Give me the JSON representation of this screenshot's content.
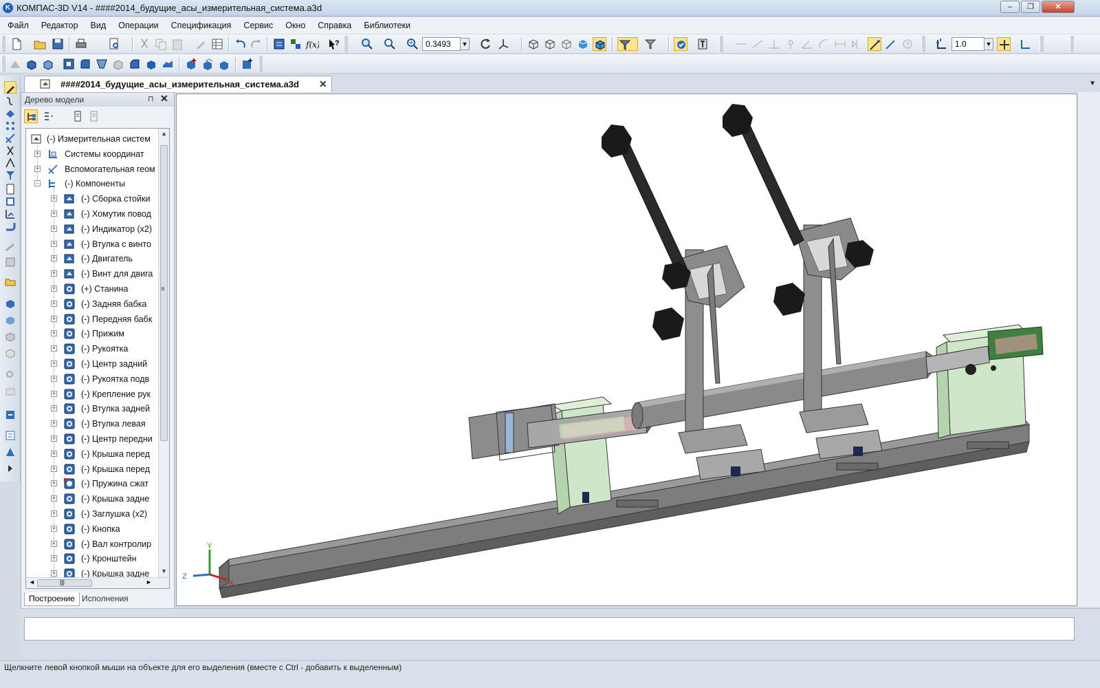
{
  "window": {
    "title": "КОМПАС-3D V14 - ####2014_будущие_асы_измерительная_система.a3d",
    "app_icon_letter": "K"
  },
  "menu": [
    "Файл",
    "Редактор",
    "Вид",
    "Операции",
    "Спецификация",
    "Сервис",
    "Окно",
    "Справка",
    "Библиотеки"
  ],
  "toolbar": {
    "zoom_value": "0.3493",
    "step_value": "1.0"
  },
  "document_tab": {
    "label": "####2014_будущие_асы_измерительная_система.a3d",
    "close_glyph": "✕"
  },
  "model_tree": {
    "title": "Дерево модели",
    "pin_glyph": "⊓",
    "close_glyph": "✕",
    "rows": [
      {
        "label": "(-) Измерительная систем",
        "level": 0,
        "expander": "",
        "icon": "assembly-icon"
      },
      {
        "label": "Системы координат",
        "level": 1,
        "expander": "+",
        "icon": "coordinate-system-icon"
      },
      {
        "label": "Вспомогательная геом",
        "level": 1,
        "expander": "+",
        "icon": "auxiliary-geometry-icon"
      },
      {
        "label": "(-) Компоненты",
        "level": 1,
        "expander": "-",
        "icon": "components-icon"
      },
      {
        "label": "(-) Сборка стойки",
        "level": 2,
        "expander": "+",
        "icon": "subassembly-icon"
      },
      {
        "label": "(-) Хомутик повод",
        "level": 2,
        "expander": "+",
        "icon": "subassembly-icon"
      },
      {
        "label": "(-) Индикатор (x2)",
        "level": 2,
        "expander": "+",
        "icon": "subassembly-icon"
      },
      {
        "label": "(-) Втулка с винто",
        "level": 2,
        "expander": "+",
        "icon": "subassembly-icon"
      },
      {
        "label": "(-) Двигатель",
        "level": 2,
        "expander": "+",
        "icon": "subassembly-icon"
      },
      {
        "label": "(-) Винт для двига",
        "level": 2,
        "expander": "+",
        "icon": "subassembly-icon"
      },
      {
        "label": "(+) Станина",
        "level": 2,
        "expander": "+",
        "icon": "part-icon"
      },
      {
        "label": "(-) Задняя бабка",
        "level": 2,
        "expander": "+",
        "icon": "part-icon"
      },
      {
        "label": "(-) Передняя бабк",
        "level": 2,
        "expander": "+",
        "icon": "part-icon"
      },
      {
        "label": "(-) Прижим",
        "level": 2,
        "expander": "+",
        "icon": "part-icon"
      },
      {
        "label": "(-) Рукоятка",
        "level": 2,
        "expander": "+",
        "icon": "part-icon"
      },
      {
        "label": "(-) Центр задний",
        "level": 2,
        "expander": "+",
        "icon": "part-icon"
      },
      {
        "label": "(-) Рукоятка подв",
        "level": 2,
        "expander": "+",
        "icon": "part-icon"
      },
      {
        "label": "(-) Крепление рук",
        "level": 2,
        "expander": "+",
        "icon": "part-icon"
      },
      {
        "label": "(-) Втулка задней",
        "level": 2,
        "expander": "+",
        "icon": "part-icon"
      },
      {
        "label": "(-) Втулка левая",
        "level": 2,
        "expander": "+",
        "icon": "part-icon"
      },
      {
        "label": "(-) Центр передни",
        "level": 2,
        "expander": "+",
        "icon": "part-icon"
      },
      {
        "label": "(-) Крышка перед",
        "level": 2,
        "expander": "+",
        "icon": "part-icon"
      },
      {
        "label": "(-) Крышка перед",
        "level": 2,
        "expander": "+",
        "icon": "part-icon"
      },
      {
        "label": "(-) Пружина сжат",
        "level": 2,
        "expander": "+",
        "icon": "part-warning-icon"
      },
      {
        "label": "(-) Крышка задне",
        "level": 2,
        "expander": "+",
        "icon": "part-icon"
      },
      {
        "label": "(-) Заглушка (x2)",
        "level": 2,
        "expander": "+",
        "icon": "part-icon"
      },
      {
        "label": "(-) Кнопка",
        "level": 2,
        "expander": "+",
        "icon": "part-icon"
      },
      {
        "label": "(-) Вал контролир",
        "level": 2,
        "expander": "+",
        "icon": "part-icon"
      },
      {
        "label": "(-) Кронштейн",
        "level": 2,
        "expander": "+",
        "icon": "part-icon"
      },
      {
        "label": "(-) Крышка задне",
        "level": 2,
        "expander": "+",
        "icon": "part-icon"
      }
    ],
    "bottom_tabs": [
      "Построение",
      "Исполнения"
    ],
    "scroll_glyphs": {
      "up": "▲",
      "down": "▼",
      "left": "◄",
      "right": "►",
      "grip": "≡",
      "hgrip": "|||"
    }
  },
  "viewport": {
    "axes": {
      "x": "X",
      "y": "Y",
      "z": "Z"
    }
  },
  "property_bar": {
    "value": ""
  },
  "status": {
    "text": "Щелкните левой кнопкой мыши на объекте для его выделения (вместе с Ctrl - добавить к выделенным)"
  },
  "colors": {
    "accent": "#1f5fb8",
    "active_button": "#ffe48a",
    "part_gray": "#8a8a8a",
    "part_green": "#cfe6c8",
    "handle_black": "#1a1a1a"
  }
}
